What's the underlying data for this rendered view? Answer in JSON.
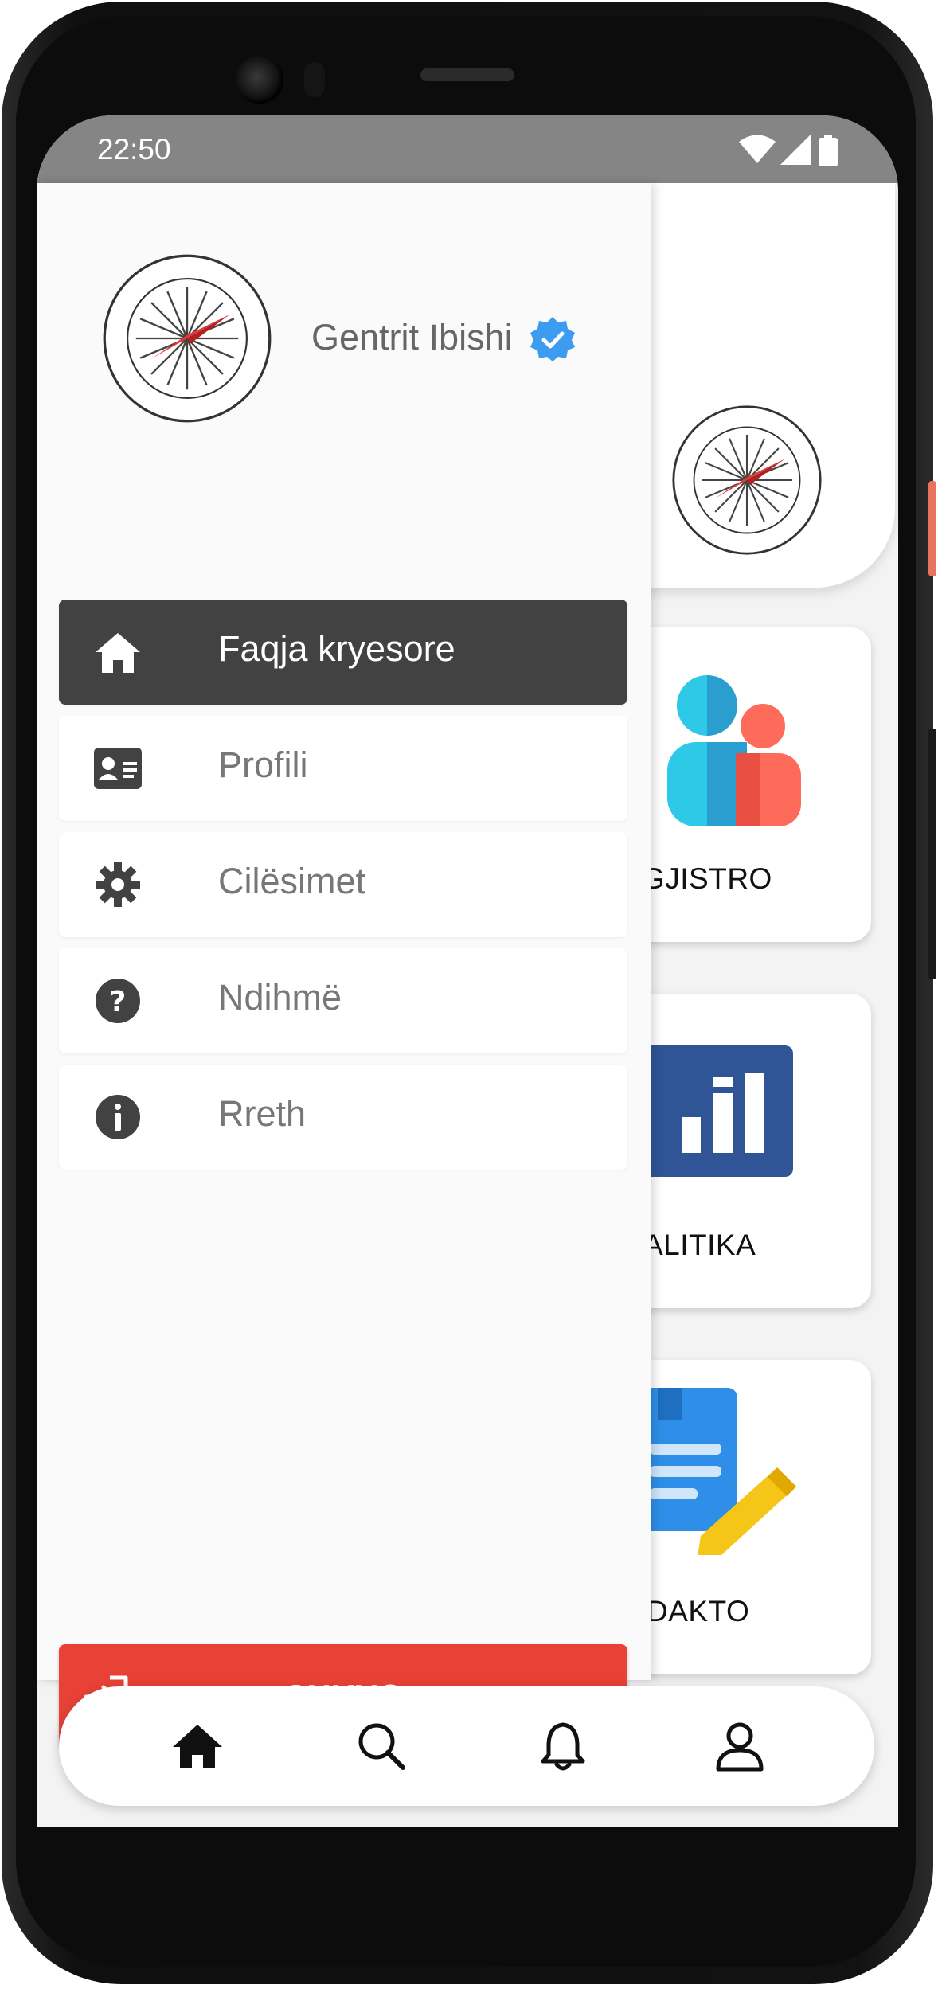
{
  "status_bar": {
    "time": "22:50"
  },
  "drawer": {
    "user_name": "Gentrit Ibishi",
    "menu": [
      {
        "label": "Faqja kryesore",
        "icon": "home-icon",
        "active": true
      },
      {
        "label": "Profili",
        "icon": "id-card-icon",
        "active": false
      },
      {
        "label": "Cilësimet",
        "icon": "gear-icon",
        "active": false
      },
      {
        "label": "Ndihmë",
        "icon": "help-icon",
        "active": false
      },
      {
        "label": "Rreth",
        "icon": "info-icon",
        "active": false
      }
    ],
    "logout_label": "SHKYÇ"
  },
  "cards": [
    {
      "label": "GJISTRO",
      "icon": "users-icon"
    },
    {
      "label": "ALITIKA",
      "icon": "analytics-icon"
    },
    {
      "label": "DAKTO",
      "icon": "edit-document-icon"
    }
  ],
  "bottom_nav": [
    "home-icon",
    "search-icon",
    "bell-icon",
    "profile-icon"
  ],
  "colors": {
    "accent_red": "#e84136",
    "active_item": "#424242",
    "verified_blue": "#3b9cf0",
    "status_bar": "#858585"
  }
}
